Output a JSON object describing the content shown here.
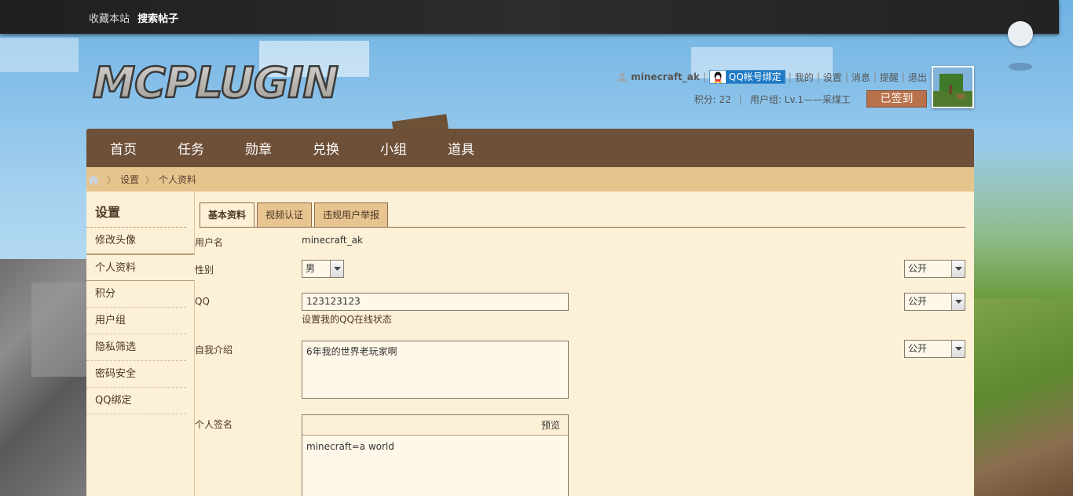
{
  "topbar": {
    "bookmark": "收藏本站",
    "search_posts": "搜索帖子"
  },
  "logo": {
    "text": "MCPLUGIN"
  },
  "user": {
    "username": "minecraft_ak",
    "qq_bind": "QQ帐号绑定",
    "links": [
      "我的",
      "设置",
      "消息",
      "提醒",
      "退出"
    ],
    "points": "积分: 22",
    "group": "用户组: Lv.1——采煤工",
    "checkin": "已签到"
  },
  "nav": {
    "items": [
      "首页",
      "任务",
      "勋章",
      "兑换",
      "小组",
      "道具"
    ]
  },
  "breadcrumb": {
    "items": [
      "设置",
      "个人资料"
    ]
  },
  "sidebar": {
    "title": "设置",
    "items": [
      "修改头像",
      "个人资料",
      "积分",
      "用户组",
      "隐私筛选",
      "密码安全",
      "QQ绑定"
    ]
  },
  "tabs": [
    "基本资料",
    "视频认证",
    "违规用户举报"
  ],
  "form": {
    "username_label": "用户名",
    "username_value": "minecraft_ak",
    "gender_label": "性别",
    "gender_value": "男",
    "gender_privacy": "公开",
    "qq_label": "QQ",
    "qq_value": "123123123",
    "qq_hint": "设置我的QQ在线状态",
    "qq_privacy": "公开",
    "intro_label": "自我介绍",
    "intro_value": "6年我的世界老玩家啊",
    "intro_privacy": "公开",
    "sig_label": "个人签名",
    "sig_preview": "预览",
    "sig_value": "minecraft=a world"
  },
  "colors": {
    "nav_bg": "#6e4f37",
    "breadcrumb_bg": "#e6c48d",
    "panel_bg": "#fcf0d6",
    "checkin_bg": "#b8714a",
    "qq_blue": "#1f7ac6"
  },
  "icons": {
    "user": "user-icon",
    "qq": "qq-penguin-icon",
    "home": "home-icon",
    "caret": "chevron-down-icon"
  }
}
